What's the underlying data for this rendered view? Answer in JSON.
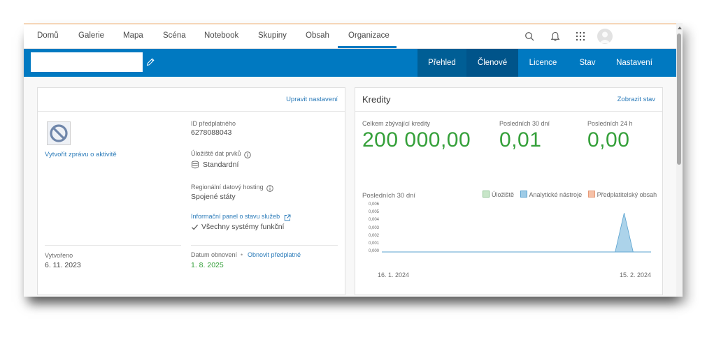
{
  "topnav": {
    "items": [
      "Domů",
      "Galerie",
      "Mapa",
      "Scéna",
      "Notebook",
      "Skupiny",
      "Obsah",
      "Organizace"
    ],
    "active_index": 7
  },
  "icons": {
    "search": "search-icon",
    "notifications": "bell-icon",
    "apps": "app-launcher-icon",
    "edit": "pencil-icon"
  },
  "colors": {
    "brand_blue": "#0079c1",
    "active_tab": "#00548a",
    "credit_green": "#35a03a",
    "link_blue": "#2b7bb9"
  },
  "subnav": {
    "tabs": [
      "Přehled",
      "Členové",
      "Licence",
      "Stav",
      "Nastavení"
    ],
    "active_index": 1
  },
  "overview": {
    "edit_settings": "Upravit nastavení",
    "activity_report": "Vytvořit zprávu o aktivitě",
    "subscription_id_label": "ID předplatného",
    "subscription_id": "6278088043",
    "feature_storage_label": "Úložiště dat prvků",
    "feature_storage_value": "Standardní",
    "regional_hosting_label": "Regionální datový hosting",
    "regional_hosting_value": "Spojené státy",
    "health_dashboard_link": "Informační panel o stavu služeb",
    "systems_status": "Všechny systémy funkční",
    "created_label": "Vytvořeno",
    "created_date": "6. 11. 2023",
    "renewal_label": "Datum obnovení",
    "renew_link": "Obnovit předplatné",
    "renewal_date": "1. 8. 2025"
  },
  "credits": {
    "title": "Kredity",
    "view_status": "Zobrazit stav",
    "total_label": "Celkem zbývající kredity",
    "total_value": "200 000,00",
    "last30_label": "Posledních 30 dní",
    "last30_value": "0,01",
    "last24_label": "Posledních 24 h",
    "last24_value": "0,00",
    "chart_heading": "Posledních 30 dní"
  },
  "chart_data": {
    "type": "area",
    "title": "Posledních 30 dní",
    "x_tick_labels": [
      "16. 1. 2024",
      "15. 2. 2024"
    ],
    "y_tick_labels": [
      "0,006",
      "0,005",
      "0,004",
      "0,003",
      "0,002",
      "0,001",
      "0,000"
    ],
    "ylim": [
      0,
      0.006
    ],
    "legend_position": "top-right",
    "x": [
      "16. 1.",
      "17. 1.",
      "18. 1.",
      "19. 1.",
      "20. 1.",
      "21. 1.",
      "22. 1.",
      "23. 1.",
      "24. 1.",
      "25. 1.",
      "26. 1.",
      "27. 1.",
      "28. 1.",
      "29. 1.",
      "30. 1.",
      "31. 1.",
      "1. 2.",
      "2. 2.",
      "3. 2.",
      "4. 2.",
      "5. 2.",
      "6. 2.",
      "7. 2.",
      "8. 2.",
      "9. 2.",
      "10. 2.",
      "11. 2.",
      "12. 2.",
      "13. 2.",
      "14. 2.",
      "15. 2."
    ],
    "series": [
      {
        "name": "Úložiště",
        "color": "#c8e6c9",
        "values": [
          0,
          0,
          0,
          0,
          0,
          0,
          0,
          0,
          0,
          0,
          0,
          0,
          0,
          0,
          0,
          0,
          0,
          0,
          0,
          0,
          0,
          0,
          0,
          0,
          0,
          0,
          0,
          0,
          0,
          0,
          0
        ]
      },
      {
        "name": "Analytické nástroje",
        "color": "#9ecbe6",
        "values": [
          0,
          0,
          0,
          0,
          0,
          0,
          0,
          0,
          0,
          0,
          0,
          0,
          0,
          0,
          0,
          0,
          0,
          0,
          0,
          0,
          0,
          0,
          0,
          0,
          0,
          0,
          0,
          0.005,
          0,
          0,
          0
        ]
      },
      {
        "name": "Předplatitelský obsah",
        "color": "#f6c1a7",
        "values": [
          0,
          0,
          0,
          0,
          0,
          0,
          0,
          0,
          0,
          0,
          0,
          0,
          0,
          0,
          0,
          0,
          0,
          0,
          0,
          0,
          0,
          0,
          0,
          0,
          0,
          0,
          0,
          0,
          0,
          0,
          0
        ]
      }
    ]
  }
}
